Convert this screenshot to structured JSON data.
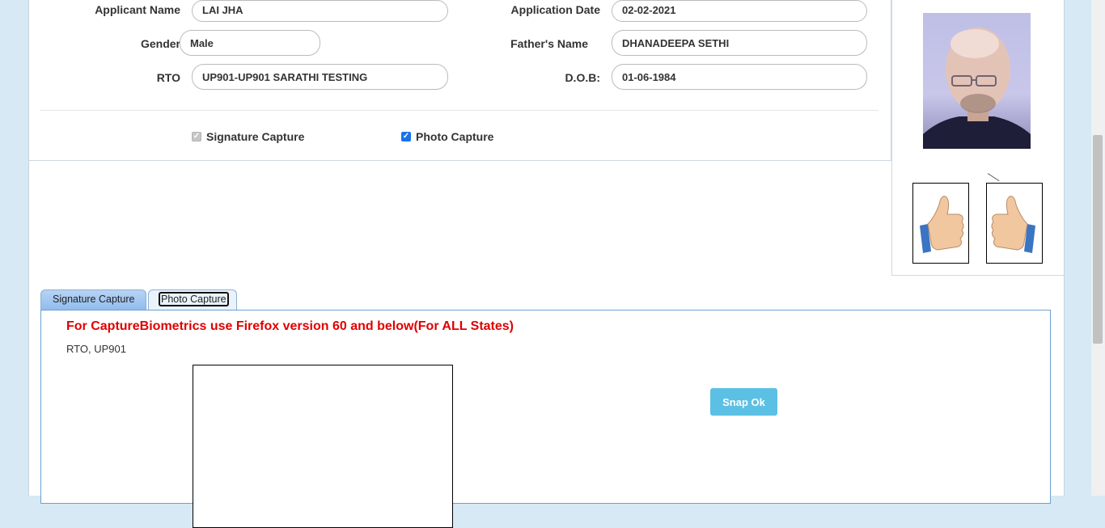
{
  "form": {
    "applicant_name_label": "Applicant Name",
    "applicant_name_value": "LAI JHA",
    "application_date_label": "Application Date",
    "application_date_value": "02-02-2021",
    "gender_label": "Gender",
    "gender_value": "Male",
    "fathers_name_label": "Father's Name",
    "fathers_name_value": "DHANADEEPA SETHI",
    "rto_label": "RTO",
    "rto_value": "UP901-UP901 SARATHI TESTING",
    "dob_label": "D.O.B:",
    "dob_value": "01-06-1984"
  },
  "checkboxes": {
    "signature_capture": {
      "label": "Signature Capture",
      "checked": true,
      "disabled": true
    },
    "photo_capture": {
      "label": "Photo Capture",
      "checked": true,
      "disabled": false
    }
  },
  "tabs": [
    {
      "label": "Signature Capture",
      "active": false
    },
    {
      "label": "Photo Capture",
      "active": true
    }
  ],
  "capture": {
    "warning": "For CaptureBiometrics use Firefox version 60 and below(For ALL States)",
    "rto_info": "RTO, UP901",
    "snap_button": "Snap Ok"
  },
  "icons": [
    "check-icon",
    "thumbs-up-left-icon",
    "thumbs-up-right-icon"
  ],
  "colors": {
    "warning": "#e00000",
    "snap_button": "#5bc0e4",
    "checkbox": "#1a73e8",
    "background": "#d6e9f5"
  }
}
